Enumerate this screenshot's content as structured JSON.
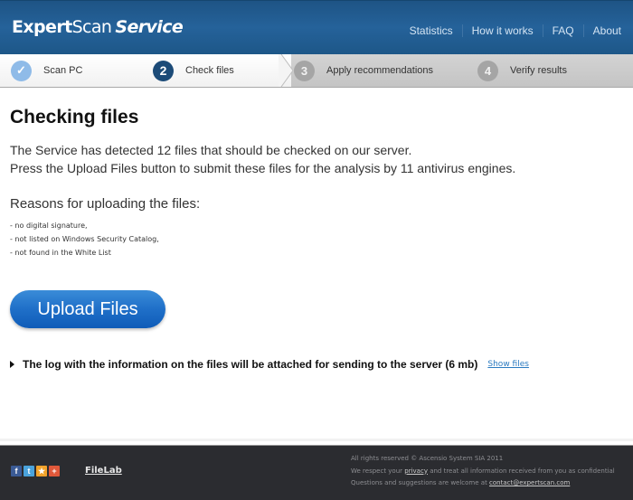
{
  "header": {
    "logo": {
      "part1": "Expert",
      "part2": "Scan",
      "part3": "Service"
    },
    "nav": [
      "Statistics",
      "How it works",
      "FAQ",
      "About"
    ]
  },
  "steps": [
    {
      "number": "✓",
      "label": "Scan PC",
      "state": "done"
    },
    {
      "number": "2",
      "label": "Check files",
      "state": "active"
    },
    {
      "number": "3",
      "label": "Apply recommendations",
      "state": "todo"
    },
    {
      "number": "4",
      "label": "Verify results",
      "state": "todo"
    }
  ],
  "main": {
    "title": "Checking files",
    "description_line1": "The Service has detected 12 files that should be checked on our server.",
    "description_line2": "Press the Upload Files button to submit these files for the analysis by 11 antivirus engines.",
    "reasons_title": "Reasons for uploading the files:",
    "reasons": [
      "- no digital signature,",
      "- not listed on Windows Security Catalog,",
      "- not found in the White List"
    ],
    "upload_button": "Upload Files",
    "log_text": "The log with the information on the files will be attached for sending to the server (6 mb)",
    "show_files_link": "Show files"
  },
  "footer": {
    "social": [
      {
        "icon": "facebook-icon",
        "glyph": "f"
      },
      {
        "icon": "twitter-icon",
        "glyph": "t"
      },
      {
        "icon": "favorite-star-icon",
        "glyph": "★"
      },
      {
        "icon": "add-plus-icon",
        "glyph": "+"
      }
    ],
    "filelab_link": "FileLab",
    "copyright": "All rights reserved © Ascensio System SIA 2011",
    "privacy_prefix": "We respect your ",
    "privacy_link": "privacy",
    "privacy_suffix": " and treat all information received from you as confidential",
    "contact_prefix": "Questions and suggestions are welcome at ",
    "contact_link": "contact@expertscan.com"
  },
  "colors": {
    "header_bg": "#25629a",
    "active_step": "#1c4b78",
    "done_step": "#8fbbe8",
    "upload_button": "#1f6fc8",
    "link": "#2a7ac0",
    "footer_bg": "#2b2c30"
  }
}
